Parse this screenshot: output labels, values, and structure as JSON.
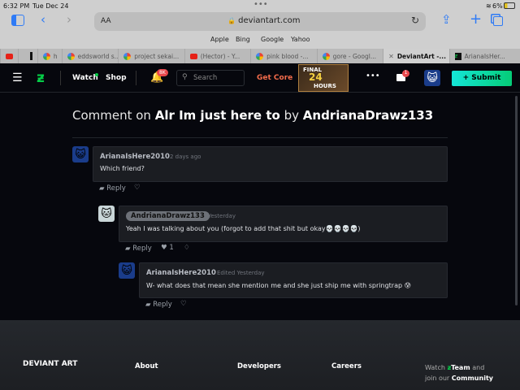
{
  "status": {
    "time": "6:32 PM",
    "date": "Tue Dec 24",
    "battery": "6%"
  },
  "browser": {
    "url": "deviantart.com",
    "text_size": "AA",
    "bookmarks": [
      "Apple",
      "Bing",
      "Google",
      "Yahoo"
    ],
    "tabs": [
      {
        "label": "",
        "icon": "youtube"
      },
      {
        "label": "",
        "icon": "deviantart"
      },
      {
        "label": "h",
        "icon": "google"
      },
      {
        "label": "eddsworld s...",
        "icon": "google"
      },
      {
        "label": "project sekai...",
        "icon": "google"
      },
      {
        "label": "(Hector) - Y...",
        "icon": "youtube"
      },
      {
        "label": "pink blood -...",
        "icon": "google"
      },
      {
        "label": "gore - Googl...",
        "icon": "google"
      },
      {
        "label": "DeviantArt -...",
        "icon": "close",
        "active": true
      },
      {
        "label": "ArianaIsHer...",
        "icon": "deviantart"
      }
    ]
  },
  "nav": {
    "watch": "Watch",
    "shop": "Shop",
    "notif_badge": "8K",
    "search_placeholder": "Search",
    "get_core": "Get Core",
    "promo_line1": "FINAL",
    "promo_line2": "24",
    "promo_line3": "HOURS",
    "inbox_badge": "1",
    "submit": "+ Submit"
  },
  "page": {
    "title_prefix": "Comment on",
    "title_work": "Alr Im just here to",
    "title_by": "by",
    "title_author": "AndrianaDrawz133"
  },
  "comments": [
    {
      "user": "ArianaIsHere2010",
      "time": "2 days ago",
      "text": "Which friend?",
      "reply": "Reply"
    },
    {
      "user": "AndrianaDrawz133",
      "time": "Yesterday",
      "text": "Yeah I was talking about you (forgot to add that shit but okay💀💀💀💀)",
      "reply": "Reply",
      "likes": "1"
    },
    {
      "user": "ArianaIsHere2010",
      "time": "Edited Yesterday",
      "text": "W- what does that mean she mention me and she just ship me with springtrap 😰",
      "reply": "Reply"
    }
  ],
  "footer": {
    "logo": "DEVIANT ART",
    "links": [
      "About",
      "Developers",
      "Careers"
    ],
    "watch_text1": "Watch",
    "watch_team": "Team",
    "watch_text2": "and",
    "join_text": "join our",
    "community": "Community"
  }
}
